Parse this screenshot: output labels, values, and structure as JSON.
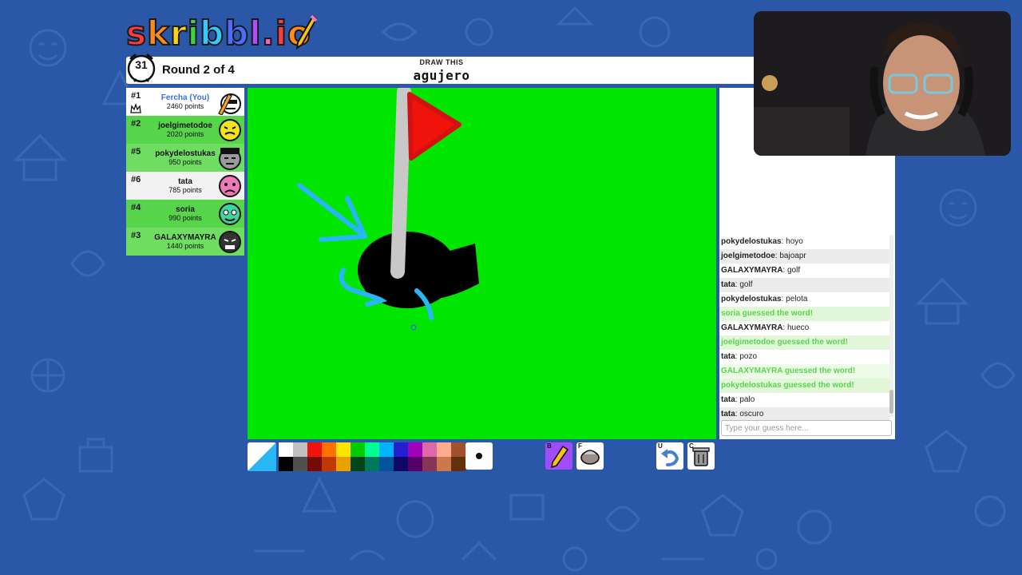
{
  "game": {
    "logo": "skribbl.io",
    "round_text": "Round 2 of 4",
    "timer": "31",
    "draw_this": "DRAW THIS",
    "word": "agujero"
  },
  "players": [
    {
      "rank": "#1",
      "name": "Fercha (You)",
      "points": "2460 points",
      "is_you": true,
      "avatar_color": "#ffffff"
    },
    {
      "rank": "#2",
      "name": "joelgimetodoe",
      "points": "2020 points",
      "is_you": false,
      "avatar_color": "#f2e21c"
    },
    {
      "rank": "#5",
      "name": "pokydelostukas",
      "points": "950 points",
      "is_you": false,
      "avatar_color": "#9a9a9a"
    },
    {
      "rank": "#6",
      "name": "tata",
      "points": "785 points",
      "is_you": false,
      "avatar_color": "#f07ab8"
    },
    {
      "rank": "#4",
      "name": "soria",
      "points": "990 points",
      "is_you": false,
      "avatar_color": "#3ed6a0"
    },
    {
      "rank": "#3",
      "name": "GALAXYMAYRA",
      "points": "1440 points",
      "is_you": false,
      "avatar_color": "#333333"
    }
  ],
  "chat": {
    "messages": [
      {
        "user": "pokydelostukas",
        "text": "hoyo",
        "type": "chat"
      },
      {
        "user": "joelgimetodoe",
        "text": "bajoapr",
        "type": "chat"
      },
      {
        "user": "GALAXYMAYRA",
        "text": "golf",
        "type": "chat"
      },
      {
        "user": "tata",
        "text": "golf",
        "type": "chat"
      },
      {
        "user": "pokydelostukas",
        "text": "pelota",
        "type": "chat"
      },
      {
        "user": "",
        "text": "soria guessed the word!",
        "type": "guessed"
      },
      {
        "user": "GALAXYMAYRA",
        "text": "hueco",
        "type": "chat"
      },
      {
        "user": "",
        "text": "joelgimetodoe guessed the word!",
        "type": "guessed"
      },
      {
        "user": "tata",
        "text": "pozo",
        "type": "chat"
      },
      {
        "user": "",
        "text": "GALAXYMAYRA guessed the word!",
        "type": "guessed"
      },
      {
        "user": "",
        "text": "pokydelostukas guessed the word!",
        "type": "guessed"
      },
      {
        "user": "tata",
        "text": "palo",
        "type": "chat"
      },
      {
        "user": "tata",
        "text": "oscuro",
        "type": "chat"
      }
    ],
    "guess_placeholder": "Type your guess here..."
  },
  "toolbar": {
    "colors_top": [
      "#ffffff",
      "#c1c1c1",
      "#ef130b",
      "#ff7100",
      "#ffe400",
      "#00cc00",
      "#00ff91",
      "#00b2ff",
      "#231fd3",
      "#a300ba",
      "#df69a7",
      "#ffac8e",
      "#a0522d"
    ],
    "colors_bottom": [
      "#000000",
      "#505050",
      "#740b07",
      "#c23800",
      "#e8a200",
      "#004619",
      "#00785d",
      "#00569e",
      "#0e0865",
      "#550069",
      "#873554",
      "#cc774d",
      "#63300d"
    ],
    "selected_color": "#00e600",
    "brush_hotkey": "B",
    "fill_hotkey": "F",
    "undo_hotkey": "U",
    "clear_hotkey": "C"
  },
  "icons": {
    "timer": "alarm-clock-icon",
    "brush": "pencil-icon",
    "fill": "paint-bucket-icon",
    "undo": "undo-icon",
    "clear": "trash-icon"
  }
}
